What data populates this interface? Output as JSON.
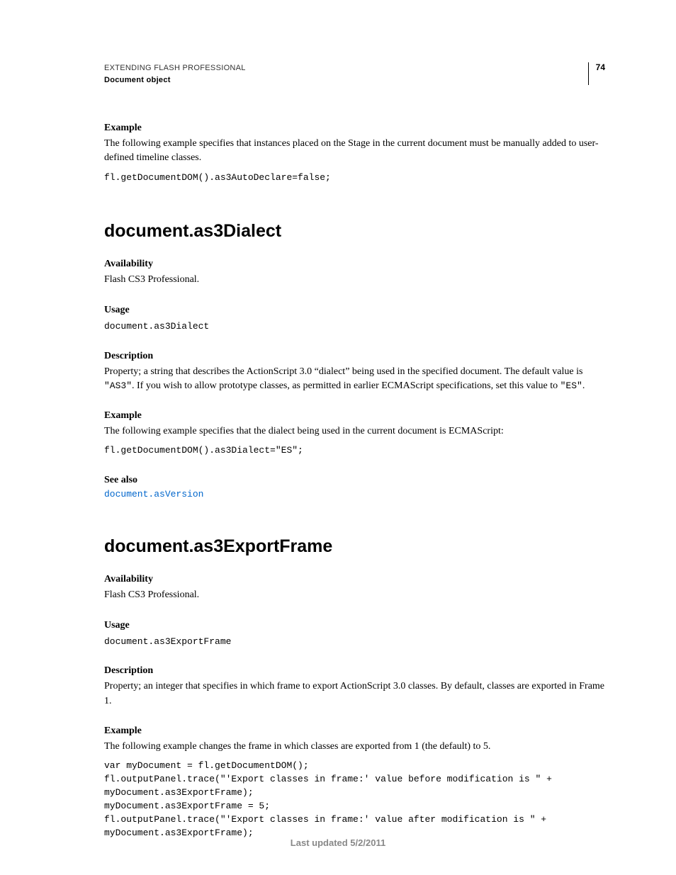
{
  "header": {
    "title": "EXTENDING FLASH PROFESSIONAL",
    "subtitle": "Document object",
    "pageNumber": "74"
  },
  "topExample": {
    "label": "Example",
    "text": "The following example specifies that instances placed on the Stage in the current document must be manually added to user-defined timeline classes.",
    "code": "fl.getDocumentDOM().as3AutoDeclare=false;"
  },
  "section1": {
    "heading": "document.as3Dialect",
    "availability": {
      "label": "Availability",
      "text": "Flash CS3 Professional."
    },
    "usage": {
      "label": "Usage",
      "code": "document.as3Dialect"
    },
    "description": {
      "label": "Description",
      "pre": "Property; a string that describes the ActionScript 3.0 “dialect” being used in the specified document. The default value is ",
      "code1": "\"AS3\"",
      "mid": ". If you wish to allow prototype classes, as permitted in earlier ECMAScript specifications, set this value to ",
      "code2": "\"ES\"",
      "post": "."
    },
    "example": {
      "label": "Example",
      "text": "The following example specifies that the dialect being used in the current document is ECMAScript:",
      "code": "fl.getDocumentDOM().as3Dialect=\"ES\";"
    },
    "seeAlso": {
      "label": "See also",
      "link": "document.asVersion"
    }
  },
  "section2": {
    "heading": "document.as3ExportFrame",
    "availability": {
      "label": "Availability",
      "text": "Flash CS3 Professional."
    },
    "usage": {
      "label": "Usage",
      "code": "document.as3ExportFrame"
    },
    "description": {
      "label": "Description",
      "text": "Property; an integer that specifies in which frame to export ActionScript 3.0 classes. By default, classes are exported in Frame 1."
    },
    "example": {
      "label": "Example",
      "text": "The following example changes the frame in which classes are exported from 1 (the default) to 5.",
      "code": "var myDocument = fl.getDocumentDOM();\nfl.outputPanel.trace(\"'Export classes in frame:' value before modification is \" + \nmyDocument.as3ExportFrame);\nmyDocument.as3ExportFrame = 5;\nfl.outputPanel.trace(\"'Export classes in frame:' value after modification is \" + \nmyDocument.as3ExportFrame);"
    }
  },
  "footer": "Last updated 5/2/2011"
}
